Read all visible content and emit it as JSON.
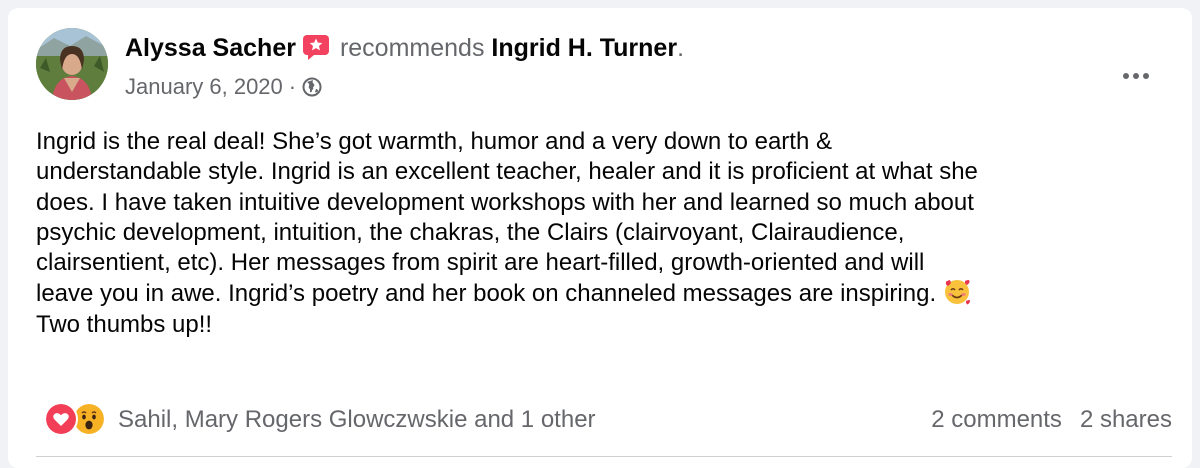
{
  "post": {
    "author": "Alyssa Sacher",
    "action": "recommends",
    "target": "Ingrid H. Turner",
    "target_suffix": ".",
    "date": "January 6, 2020",
    "separator": "·",
    "audience_icon": "globe-icon",
    "recommend_icon": "recommendation-badge-icon",
    "body_text": "Ingrid is the real deal! She’s got warmth, humor and a very down to earth &\nunderstandable style. Ingrid is an excellent teacher, healer and it is proficient at what she\ndoes. I have taken intuitive development workshops with her and learned so much about\npsychic development, intuition, the chakras, the Clairs (clairvoyant, Clairaudience,\nclairsentient, etc). Her messages from spirit are heart-filled, growth-oriented and will\nleave you in awe. Ingrid’s poetry and her book on channeled messages are inspiring. ",
    "body_emoji": "smiling-face-with-hearts-icon",
    "body_text_end": "\nTwo thumbs up!!"
  },
  "footer": {
    "reaction_icons": [
      "love-reaction-icon",
      "wow-reaction-icon"
    ],
    "reacted_by": "Sahil, Mary Rogers Glowczwskie and 1 other",
    "comments": "2 comments",
    "shares": "2 shares"
  },
  "colors": {
    "text_primary": "#050505",
    "text_secondary": "#65676b",
    "recommend_badge": "#f3425f",
    "love": "#f33e58",
    "wow": "#f7b125",
    "divider": "#ced0d4"
  }
}
